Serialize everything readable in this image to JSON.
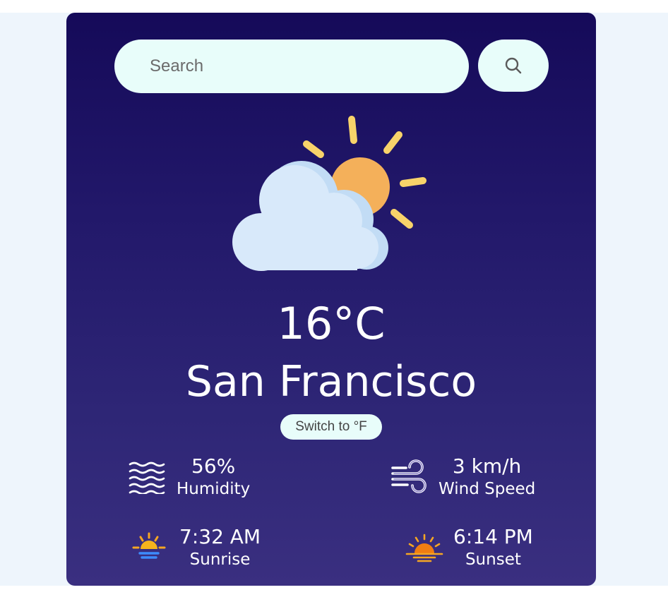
{
  "search": {
    "placeholder": "Search"
  },
  "icons": {
    "search_button": "search-icon",
    "weather": "partly-cloudy-icon",
    "humidity": "humidity-icon",
    "wind": "wind-icon",
    "sunrise": "sunrise-icon",
    "sunset": "sunset-icon"
  },
  "colors": {
    "card_top": "#150a59",
    "card_bottom": "#3a2f80",
    "input_bg": "#e8fdfa",
    "page_bg": "#eef5fc",
    "sun": "#f4b05a",
    "rays": "#f8d36a",
    "cloud": "#d8e9fa"
  },
  "weather": {
    "temperature": "16°C",
    "city": "San Francisco",
    "unit_toggle": "Switch to °F"
  },
  "stats": {
    "humidity": {
      "value": "56%",
      "label": "Humidity"
    },
    "wind": {
      "value": "3 km/h",
      "label": "Wind Speed"
    },
    "sunrise": {
      "value": "7:32 AM",
      "label": "Sunrise"
    },
    "sunset": {
      "value": "6:14 PM",
      "label": "Sunset"
    }
  }
}
